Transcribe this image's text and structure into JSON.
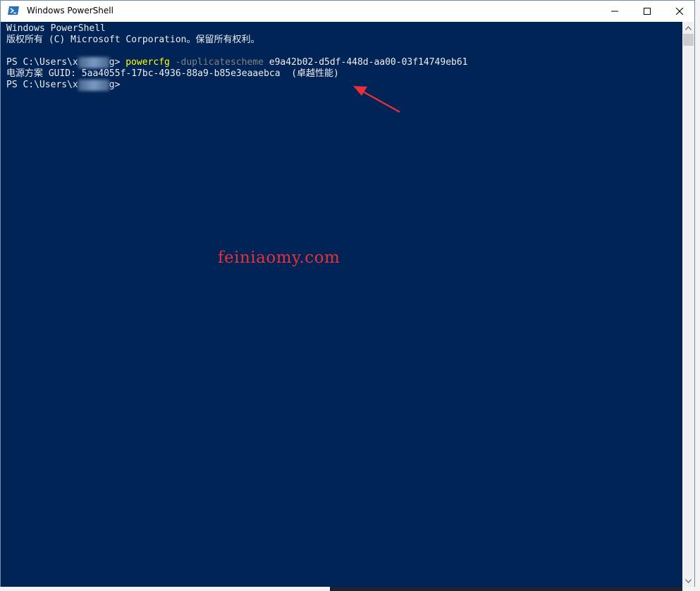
{
  "window": {
    "title": "Windows PowerShell",
    "icon": "powershell-icon",
    "buttons": {
      "minimize_icon": "minimize-icon",
      "maximize_icon": "maximize-icon",
      "close_icon": "close-icon"
    }
  },
  "console": {
    "background_color": "#012456",
    "text_color": "#eeedf0",
    "command_color": "#ffff00",
    "param_color": "#808080",
    "lines": {
      "header1": "Windows PowerShell",
      "header2": "版权所有 (C) Microsoft Corporation。保留所有权利。",
      "prompt1_prefix": "PS C:\\Users\\x",
      "prompt1_suffix": "g> ",
      "command": "powercfg",
      "param": " -duplicatescheme",
      "argument": " e9a42b02-d5df-448d-aa00-03f14749eb61",
      "result": "电源方案 GUID: 5aa4055f-17bc-4936-88a9-b85e3eaaebca  (卓越性能)",
      "prompt2_prefix": "PS C:\\Users\\x",
      "prompt2_suffix": "g>"
    }
  },
  "annotation": {
    "arrow_color": "#e8303a"
  },
  "watermark": {
    "text": "feiniaomy.com",
    "color": "#e8303a"
  },
  "scrollbar": {
    "up_icon": "scroll-up-icon",
    "down_icon": "scroll-down-icon"
  }
}
